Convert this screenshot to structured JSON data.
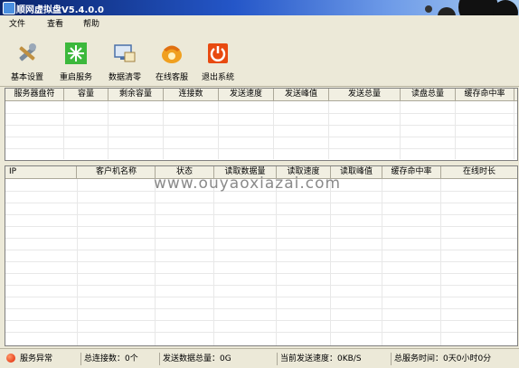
{
  "window": {
    "title": "顺网虚拟盘V5.4.0.0"
  },
  "menu": [
    "文件",
    "查看",
    "帮助"
  ],
  "toolbar": [
    {
      "label": "基本设置",
      "icon": "wrench-tools-icon"
    },
    {
      "label": "重启服务",
      "icon": "restart-service-icon"
    },
    {
      "label": "数据清零",
      "icon": "data-clear-icon"
    },
    {
      "label": "在线客服",
      "icon": "online-support-phone-icon"
    },
    {
      "label": "退出系统",
      "icon": "power-exit-icon"
    }
  ],
  "server_table": {
    "columns": [
      "服务器盘符",
      "容量",
      "剩余容量",
      "连接数",
      "发送速度",
      "发送峰值",
      "发送总量",
      "读盘总量",
      "缓存命中率"
    ]
  },
  "client_table": {
    "columns": [
      "IP",
      "客户机名称",
      "状态",
      "读取数据量",
      "读取速度",
      "读取峰值",
      "缓存命中率",
      "在线时长"
    ]
  },
  "watermark": "www.ouyaoxiazai.com",
  "status": {
    "service": "服务异常",
    "connections": "总连接数：0个",
    "sent_total": "发送数据总量：0G",
    "send_speed": "当前发送速度：0KB/S",
    "uptime": "总服务时间：0天0小时0分"
  },
  "colors": {
    "titlebar_start": "#0A246A",
    "titlebar_end": "#A6CAF0",
    "status_error": "#E02000"
  }
}
